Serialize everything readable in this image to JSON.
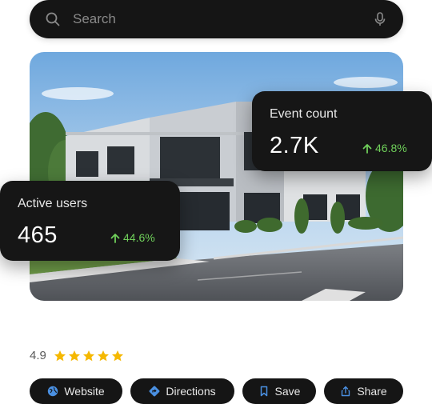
{
  "search": {
    "placeholder": "Search",
    "icon": "search-icon",
    "mic_icon": "microphone-icon"
  },
  "image": {
    "subject": "modern two-story office building with parking lot"
  },
  "cards": {
    "event": {
      "label": "Event count",
      "value": "2.7K",
      "delta": "46.8%",
      "trend_icon": "arrow-up-icon"
    },
    "active": {
      "label": "Active users",
      "value": "465",
      "delta": "44.6%",
      "trend_icon": "arrow-up-icon"
    }
  },
  "rating": {
    "value": "4.9",
    "stars": 5,
    "star_color": "#f5b800"
  },
  "actions": [
    {
      "label": "Website",
      "icon": "globe-icon"
    },
    {
      "label": "Directions",
      "icon": "directions-icon"
    },
    {
      "label": "Save",
      "icon": "bookmark-icon"
    },
    {
      "label": "Share",
      "icon": "share-icon"
    }
  ],
  "colors": {
    "card_bg": "#161616",
    "positive": "#6fcf5a",
    "accent_blue": "#4a90e2"
  }
}
